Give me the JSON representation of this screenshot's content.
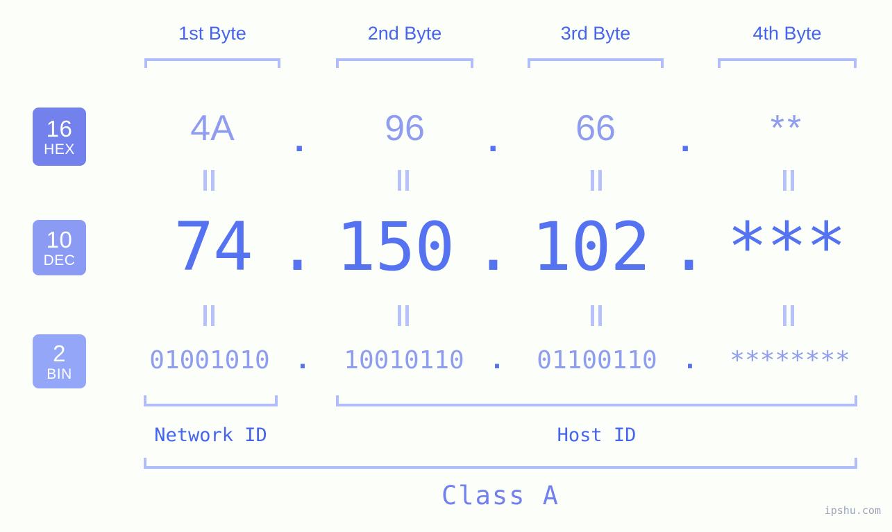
{
  "page": {
    "background_color": "#fcfefa",
    "accent_strong": "#5572f0",
    "accent_mid": "#8f9df0",
    "accent_light": "#b1bcfb",
    "header_color": "#4665ef",
    "watermark": "ipshu.com"
  },
  "byte_headers": [
    {
      "label": "1st Byte"
    },
    {
      "label": "2nd Byte"
    },
    {
      "label": "3rd Byte"
    },
    {
      "label": "4th Byte"
    }
  ],
  "bases": [
    {
      "num": "16",
      "abbr": "HEX",
      "color": "#7281ec"
    },
    {
      "num": "10",
      "abbr": "DEC",
      "color": "#8b9af3"
    },
    {
      "num": "2",
      "abbr": "BIN",
      "color": "#94a6f7"
    }
  ],
  "rows": {
    "hex": {
      "values": [
        "4A",
        "96",
        "66",
        "**"
      ],
      "separators": [
        ".",
        ".",
        "."
      ]
    },
    "dec": {
      "values": [
        "74",
        "150",
        "102",
        "***"
      ],
      "separators": [
        ".",
        ".",
        "."
      ]
    },
    "bin": {
      "values": [
        "01001010",
        "10010110",
        "01100110",
        "********"
      ],
      "separators": [
        ".",
        ".",
        "."
      ]
    }
  },
  "equals_separator": "||",
  "zones": [
    {
      "label": "Network ID"
    },
    {
      "label": "Host ID"
    }
  ],
  "class": {
    "label": "Class A"
  }
}
